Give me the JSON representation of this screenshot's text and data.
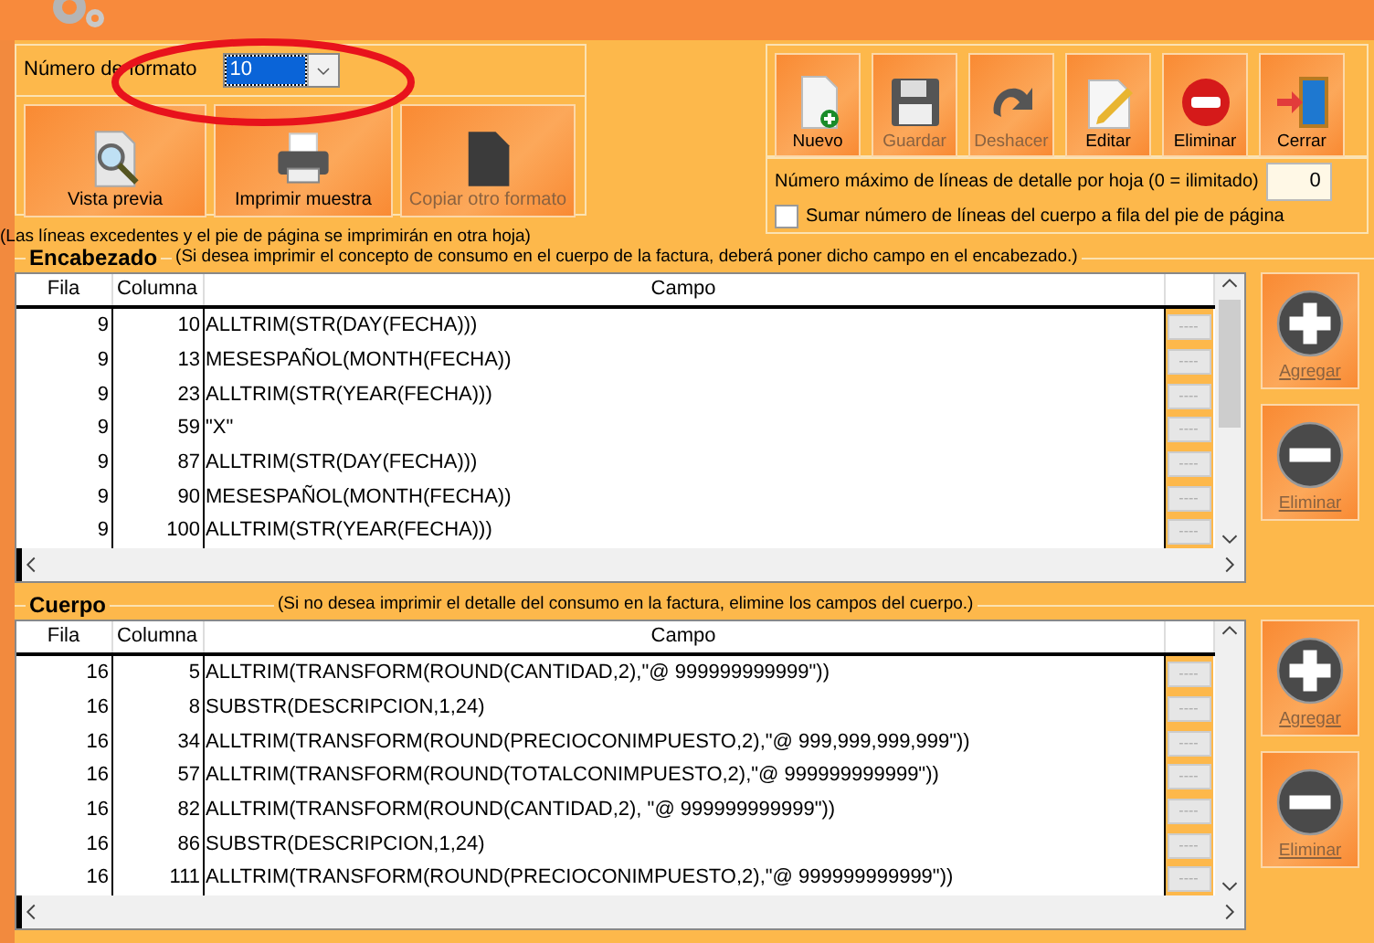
{
  "format": {
    "label": "Número de formato",
    "value": "10",
    "focused": true
  },
  "left_buttons": [
    {
      "label": "Vista previa",
      "disabled": false
    },
    {
      "label": "Imprimir muestra",
      "disabled": false
    },
    {
      "label": "Copiar otro formato",
      "disabled": true
    }
  ],
  "note": "(Las líneas excedentes y el pie de página se imprimirán en otra hoja)",
  "toolbar": [
    {
      "label": "Nuevo",
      "disabled": false
    },
    {
      "label": "Guardar",
      "disabled": true
    },
    {
      "label": "Deshacer",
      "disabled": true
    },
    {
      "label": "Editar",
      "disabled": false
    },
    {
      "label": "Eliminar",
      "disabled": false
    },
    {
      "label": "Cerrar",
      "disabled": false
    }
  ],
  "max_lines": {
    "label": "Número máximo de líneas de detalle por hoja (0 = ilimitado)",
    "value": "0"
  },
  "sum_checkbox": {
    "label": "Sumar número de líneas del cuerpo a fila del pie de página",
    "checked": false
  },
  "sections": [
    {
      "title": "Encabezado",
      "hint": "(Si desea imprimir el concepto de consumo en el cuerpo de la factura, deberá poner dicho campo en el encabezado.)",
      "columns": [
        "Fila",
        "Columna",
        "Campo"
      ],
      "rows": [
        {
          "fila": "9",
          "columna": "10",
          "campo": "ALLTRIM(STR(DAY(FECHA)))",
          "button": "----"
        },
        {
          "fila": "9",
          "columna": "13",
          "campo": "MESESPAÑOL(MONTH(FECHA))",
          "button": "----"
        },
        {
          "fila": "9",
          "columna": "23",
          "campo": "ALLTRIM(STR(YEAR(FECHA)))",
          "button": "----"
        },
        {
          "fila": "9",
          "columna": "59",
          "campo": "\"X\"",
          "button": "----"
        },
        {
          "fila": "9",
          "columna": "87",
          "campo": "ALLTRIM(STR(DAY(FECHA)))",
          "button": "----"
        },
        {
          "fila": "9",
          "columna": "90",
          "campo": "MESESPAÑOL(MONTH(FECHA))",
          "button": "----"
        },
        {
          "fila": "9",
          "columna": "100",
          "campo": "ALLTRIM(STR(YEAR(FECHA)))",
          "button": "----"
        }
      ],
      "actions": [
        {
          "label": "Agregar",
          "disabled": true
        },
        {
          "label": "Eliminar",
          "disabled": true
        }
      ]
    },
    {
      "title": "Cuerpo",
      "hint": "(Si no desea imprimir el detalle del consumo en la factura, elimine los campos del cuerpo.)",
      "columns": [
        "Fila",
        "Columna",
        "Campo"
      ],
      "rows": [
        {
          "fila": "16",
          "columna": "5",
          "campo": "ALLTRIM(TRANSFORM(ROUND(CANTIDAD,2),\"@ 999999999999\"))",
          "button": "----"
        },
        {
          "fila": "16",
          "columna": "8",
          "campo": "SUBSTR(DESCRIPCION,1,24)",
          "button": "----"
        },
        {
          "fila": "16",
          "columna": "34",
          "campo": "ALLTRIM(TRANSFORM(ROUND(PRECIOCONIMPUESTO,2),\"@ 999,999,999,999\"))",
          "button": "----"
        },
        {
          "fila": "16",
          "columna": "57",
          "campo": "ALLTRIM(TRANSFORM(ROUND(TOTALCONIMPUESTO,2),\"@ 999999999999\"))",
          "button": "----"
        },
        {
          "fila": "16",
          "columna": "82",
          "campo": "ALLTRIM(TRANSFORM(ROUND(CANTIDAD,2), \"@ 999999999999\"))",
          "button": "----"
        },
        {
          "fila": "16",
          "columna": "86",
          "campo": "SUBSTR(DESCRIPCION,1,24)",
          "button": "----"
        },
        {
          "fila": "16",
          "columna": "111",
          "campo": "ALLTRIM(TRANSFORM(ROUND(PRECIOCONIMPUESTO,2),\"@ 999999999999\"))",
          "button": "----"
        }
      ],
      "actions": [
        {
          "label": "Agregar",
          "disabled": true
        },
        {
          "label": "Eliminar",
          "disabled": true
        }
      ]
    }
  ],
  "annotation": {
    "kind": "ellipse"
  }
}
